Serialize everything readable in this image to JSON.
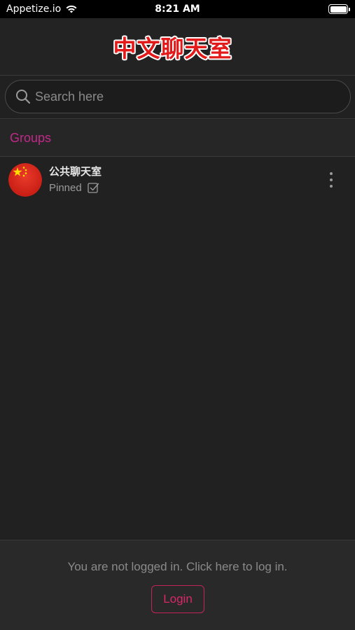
{
  "status_bar": {
    "carrier": "Appetize.io",
    "time": "8:21 AM",
    "battery_level": 1.0
  },
  "header": {
    "title": "中文聊天室"
  },
  "search": {
    "placeholder": "Search here",
    "value": ""
  },
  "groups": {
    "title": "Groups",
    "items": [
      {
        "name": "公共聊天室",
        "status": "Pinned",
        "avatar_icon": "china-flag-icon"
      }
    ]
  },
  "footer": {
    "prompt": "You are not logged in. Click here to log in.",
    "login_label": "Login"
  },
  "colors": {
    "accent_pink": "#c2298a",
    "login_red": "#d9286a",
    "title_red": "#e31a1a",
    "background": "#212121"
  }
}
